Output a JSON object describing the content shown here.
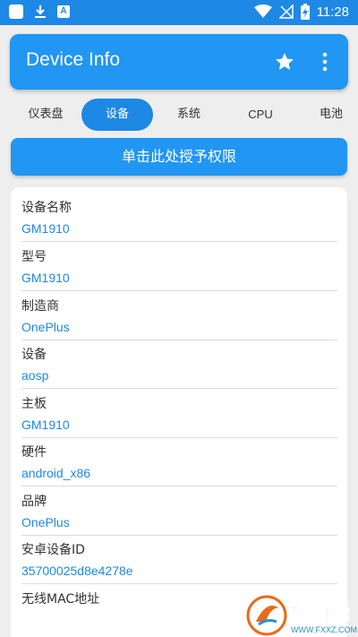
{
  "status_bar": {
    "time": "11:28",
    "icons": [
      "app-square-icon",
      "download-icon",
      "a-icon",
      "wifi-icon",
      "signal-off-icon",
      "battery-charging-icon"
    ],
    "background": "#1e88e5"
  },
  "app": {
    "title": "Device Info",
    "accent": "#2196f3",
    "icons": [
      "star-icon",
      "more-vert-icon"
    ]
  },
  "tabs": [
    {
      "label": "仪表盘"
    },
    {
      "label": "设备",
      "active": true
    },
    {
      "label": "系统"
    },
    {
      "label": "CPU"
    },
    {
      "label": "电池"
    }
  ],
  "grant_button": {
    "label": "单击此处授予权限"
  },
  "info": {
    "rows": [
      {
        "label": "设备名称",
        "value": "GM1910"
      },
      {
        "label": "型号",
        "value": "GM1910"
      },
      {
        "label": "制造商",
        "value": "OnePlus"
      },
      {
        "label": "设备",
        "value": "aosp"
      },
      {
        "label": "主板",
        "value": "GM1910"
      },
      {
        "label": "硬件",
        "value": "android_x86"
      },
      {
        "label": "品牌",
        "value": "OnePlus"
      },
      {
        "label": "安卓设备ID",
        "value": "35700025d8e4278e"
      },
      {
        "label": "无线MAC地址",
        "value": ""
      }
    ],
    "value_color": "#1e88e5"
  },
  "watermark": {
    "text": "飞翔下载",
    "url_text": "WWW.FXXZ.COM"
  }
}
